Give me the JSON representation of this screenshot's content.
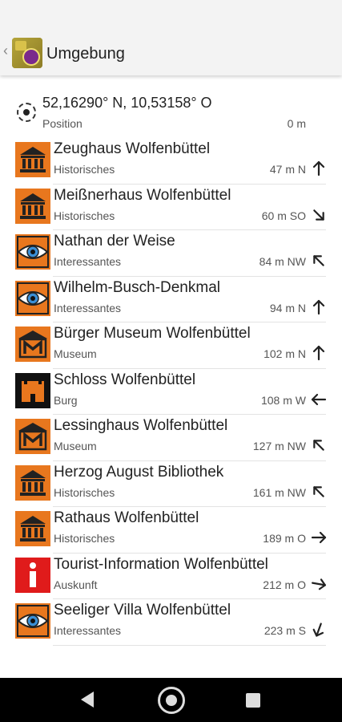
{
  "appbar": {
    "title": "Umgebung"
  },
  "position": {
    "coords": "52,16290° N, 10,53158° O",
    "label": "Position",
    "distance": "0 m"
  },
  "colors": {
    "poi_orange": "#e8771e",
    "info_red": "#e01b1b",
    "castle_black": "#111111"
  },
  "pois": [
    {
      "name": "Zeughaus Wolfenbüttel",
      "category": "Historisches",
      "distance": "47 m N",
      "icon": "museum-building-icon",
      "arrow": "arrow-north-icon",
      "bearing": 0
    },
    {
      "name": "Meißnerhaus Wolfenbüttel",
      "category": "Historisches",
      "distance": "60 m SO",
      "icon": "museum-building-icon",
      "arrow": "arrow-southeast-icon",
      "bearing": 135
    },
    {
      "name": "Nathan der Weise",
      "category": "Interessantes",
      "distance": "84 m NW",
      "icon": "eye-icon",
      "arrow": "arrow-northwest-icon",
      "bearing": 315
    },
    {
      "name": "Wilhelm-Busch-Denkmal",
      "category": "Interessantes",
      "distance": "94 m N",
      "icon": "eye-icon",
      "arrow": "arrow-north-icon",
      "bearing": 0
    },
    {
      "name": "Bürger Museum Wolfenbüttel",
      "category": "Museum",
      "distance": "102 m N",
      "icon": "museum-m-icon",
      "arrow": "arrow-north-icon",
      "bearing": 0
    },
    {
      "name": "Schloss Wolfenbüttel",
      "category": "Burg",
      "distance": "108 m W",
      "icon": "castle-icon",
      "arrow": "arrow-west-icon",
      "bearing": 270
    },
    {
      "name": "Lessinghaus Wolfenbüttel",
      "category": "Museum",
      "distance": "127 m NW",
      "icon": "museum-m-icon",
      "arrow": "arrow-northwest-icon",
      "bearing": 315
    },
    {
      "name": "Herzog August Bibliothek",
      "category": "Historisches",
      "distance": "161 m NW",
      "icon": "museum-building-icon",
      "arrow": "arrow-northwest-icon",
      "bearing": 315
    },
    {
      "name": "Rathaus Wolfenbüttel",
      "category": "Historisches",
      "distance": "189 m O",
      "icon": "museum-building-icon",
      "arrow": "arrow-east-icon",
      "bearing": 90
    },
    {
      "name": "Tourist-Information Wolfenbüttel",
      "category": "Auskunft",
      "distance": "212 m O",
      "icon": "info-icon",
      "arrow": "arrow-east-icon",
      "bearing": 100
    },
    {
      "name": "Seeliger Villa Wolfenbüttel",
      "category": "Interessantes",
      "distance": "223 m S",
      "icon": "eye-icon",
      "arrow": "arrow-south-icon",
      "bearing": 200
    }
  ]
}
